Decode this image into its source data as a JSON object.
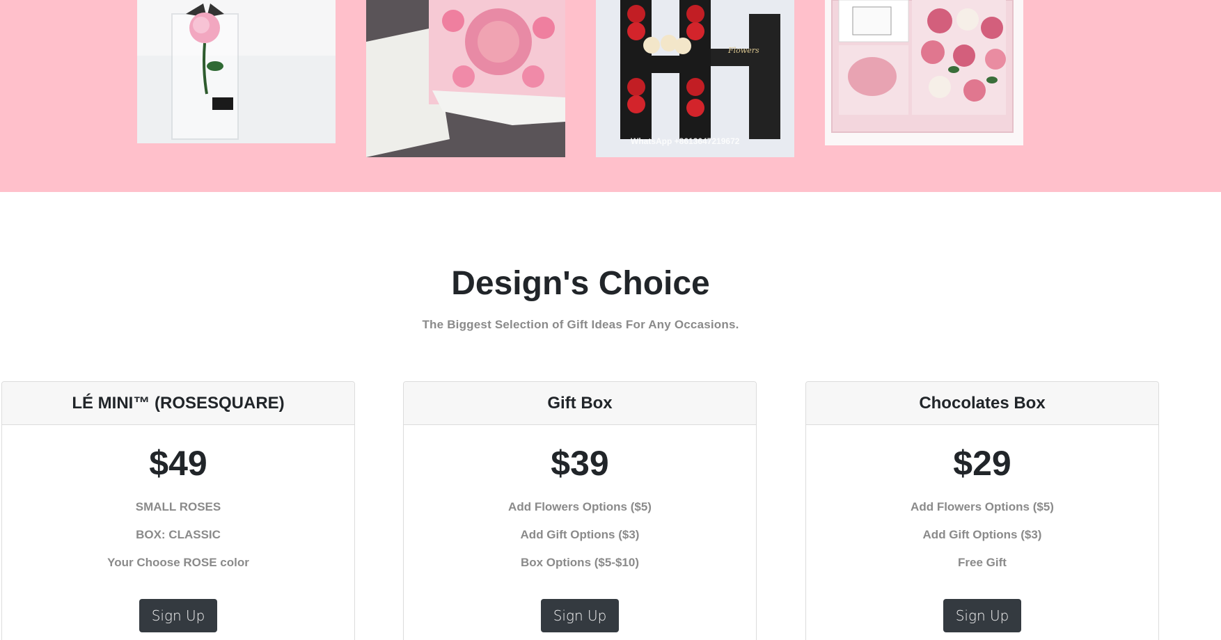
{
  "gallery": {
    "items": [
      {
        "alt": "Pink preserved rose in acrylic box",
        "icon": "rose-in-acrylic-box"
      },
      {
        "alt": "Pink roses and macarons box",
        "icon": "macaron-rose-box"
      },
      {
        "alt": "Red and cream roses in letter H box",
        "icon": "letter-h-rose-box"
      },
      {
        "alt": "Pink gift box with roses and candle",
        "icon": "pink-gift-box"
      }
    ],
    "watermark_text": "WhatsApp +8613647219672",
    "flowers_script": "Flowers",
    "background_color": "#ffc0cb"
  },
  "section": {
    "title": "Design's Choice",
    "subtitle": "The Biggest Selection of Gift Ideas For Any Occasions."
  },
  "cards": [
    {
      "title": "LÉ MINI™ (ROSESQUARE)",
      "price": "$49",
      "features": [
        "SMALL ROSES",
        "BOX: CLASSIC",
        "Your Choose ROSE color"
      ],
      "button": "Sign Up"
    },
    {
      "title": "Gift Box",
      "price": "$39",
      "features": [
        "Add Flowers Options ($5)",
        "Add Gift Options ($3)",
        "Box Options ($5-$10)"
      ],
      "button": "Sign Up"
    },
    {
      "title": "Chocolates Box",
      "price": "$29",
      "features": [
        "Add Flowers Options ($5)",
        "Add Gift Options ($3)",
        "Free Gift"
      ],
      "button": "Sign Up"
    }
  ],
  "colors": {
    "button_bg": "#343a40",
    "muted_text": "#8a8a8a",
    "heading_text": "#212529"
  }
}
